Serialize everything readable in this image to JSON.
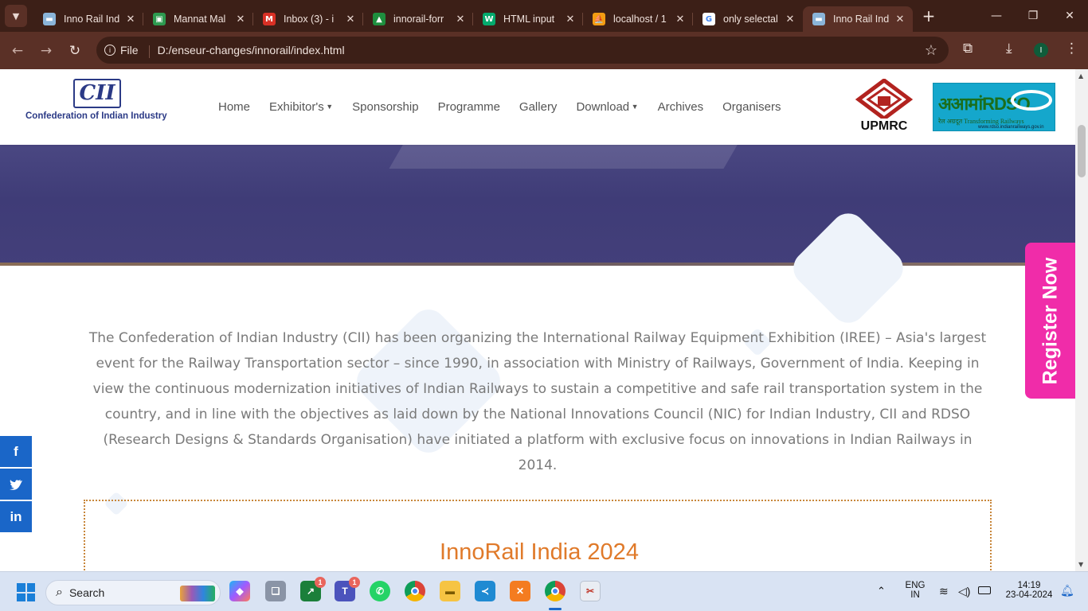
{
  "browser": {
    "tabs": [
      {
        "title": "Inno Rail Ind",
        "favicon": "cii-rail",
        "color": "#8ab4d9"
      },
      {
        "title": "Mannat Mal",
        "favicon": "chat",
        "color": "#2d9a4f"
      },
      {
        "title": "Inbox (3) - i",
        "favicon": "gmail",
        "color": "#d93025"
      },
      {
        "title": "innorail-forr",
        "favicon": "drive",
        "color": "#1e8e3e"
      },
      {
        "title": "HTML input",
        "favicon": "w3schools",
        "color": "#04aa6d"
      },
      {
        "title": "localhost / 1",
        "favicon": "phpmyadmin",
        "color": "#f39c12"
      },
      {
        "title": "only selectal",
        "favicon": "google",
        "color": "#4285f4"
      },
      {
        "title": "Inno Rail Ind",
        "favicon": "cii-rail",
        "color": "#8ab4d9",
        "active": true
      }
    ],
    "address_label": "File",
    "address_url": "D:/enseur-changes/innorail/index.html",
    "profile_initial": "I"
  },
  "site": {
    "cii_logo": "CII",
    "cii_name": "Confederation of Indian Industry",
    "nav": [
      "Home",
      "Exhibitor's",
      "Sponsorship",
      "Programme",
      "Gallery",
      "Download",
      "Archives",
      "Organisers"
    ],
    "dropdown_items": [
      "Exhibitor's",
      "Download"
    ],
    "upmrc": "UPMRC",
    "rdso_main": "अआमांRDSO",
    "rdso_sub": "रेल अग्रदूत Transforming Railways",
    "rdso_url": "www.rdso.indianrailways.gov.in",
    "about": "The Confederation of Indian Industry (CII) has been organizing the International Railway Equipment Exhibition (IREE) – Asia's largest event for the Railway Transportation sector – since 1990, in association with Ministry of Railways, Government of India. Keeping in view the continuous modernization initiatives of Indian Railways to sustain a competitive and safe rail transportation system in the country, and in line with the objectives as laid down by the National Innovations Council (NIC) for Indian Industry, CII and RDSO (Research Designs & Standards Organisation) have initiated a platform with exclusive focus on innovations in Indian Railways in 2014.",
    "section_title": "InnoRail India 2024",
    "register": "Register Now",
    "social": [
      "f",
      "t",
      "in"
    ]
  },
  "taskbar": {
    "search_placeholder": "Search",
    "lang_top": "ENG",
    "lang_bottom": "IN",
    "time": "14:19",
    "date": "23-04-2024",
    "badges": {
      "sheets": "1",
      "teams": "1"
    }
  },
  "colors": {
    "browser_frame": "#3c1f17",
    "accent_pink": "#f02ca9",
    "title_orange": "#e07a2a",
    "social_blue": "#1a66c8"
  }
}
